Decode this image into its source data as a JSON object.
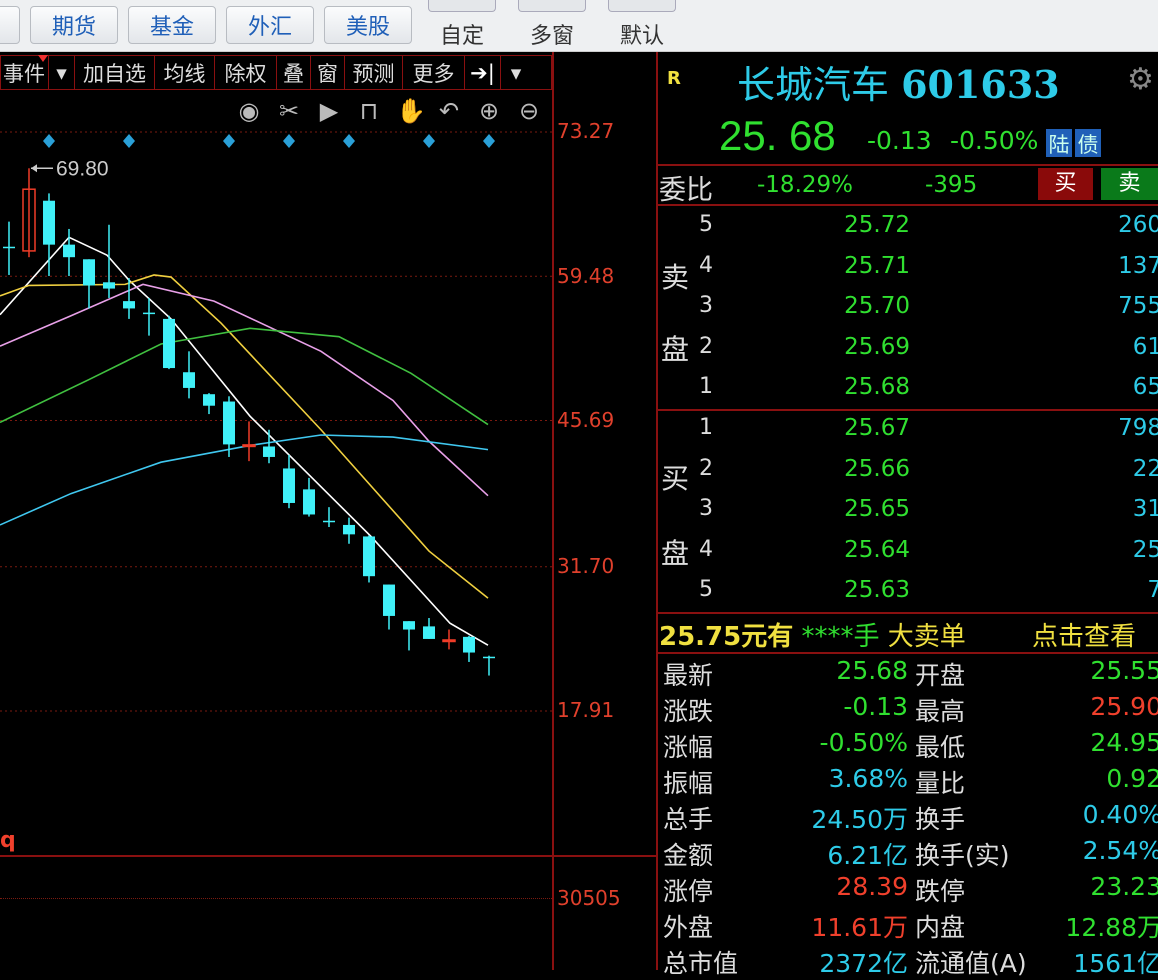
{
  "topbar": {
    "buttons": [
      "期货",
      "基金",
      "外汇",
      "美股"
    ],
    "tools": [
      "自定",
      "多窗",
      "默认"
    ]
  },
  "chart_toolbar": {
    "items": [
      "事件",
      "▾",
      "加自选",
      "均线",
      "除权",
      "叠",
      "窗",
      "预测",
      "更多",
      "➔|",
      "▾"
    ]
  },
  "chart_icons": [
    "eye-icon",
    "scissors-icon",
    "play-icon",
    "lock-icon",
    "hand-icon",
    "undo-icon",
    "zoom-in-icon",
    "zoom-out-icon"
  ],
  "chart_data": {
    "type": "candlestick",
    "y_ticks": [
      "73.27",
      "59.48",
      "45.69",
      "31.70",
      "17.91"
    ],
    "ylim": [
      17.91,
      73.27
    ],
    "high_annotation": "69.80",
    "candles": [
      [
        62.3,
        64.7,
        59.6,
        62.2
      ],
      [
        61.9,
        69.8,
        61.3,
        67.8
      ],
      [
        66.7,
        67.4,
        59.5,
        62.5
      ],
      [
        62.5,
        64.0,
        59.5,
        61.3
      ],
      [
        61.1,
        61.1,
        56.4,
        58.6
      ],
      [
        58.9,
        64.4,
        57.4,
        58.3
      ],
      [
        57.1,
        59.3,
        55.4,
        56.4
      ],
      [
        56.0,
        57.4,
        53.8,
        55.9
      ],
      [
        55.4,
        55.7,
        50.6,
        50.7
      ],
      [
        50.3,
        52.3,
        47.8,
        48.8
      ],
      [
        48.2,
        48.3,
        46.3,
        47.1
      ],
      [
        47.5,
        48.0,
        42.2,
        43.4
      ],
      [
        43.25,
        45.6,
        41.8,
        43.35
      ],
      [
        43.2,
        44.8,
        41.6,
        42.2
      ],
      [
        41.1,
        42.4,
        37.3,
        37.8
      ],
      [
        39.1,
        40.2,
        36.5,
        36.7
      ],
      [
        36.1,
        37.4,
        35.5,
        36.0
      ],
      [
        35.7,
        36.4,
        33.9,
        34.8
      ],
      [
        34.6,
        34.7,
        30.2,
        30.8
      ],
      [
        30.0,
        30.0,
        25.7,
        27.0
      ],
      [
        26.5,
        26.5,
        23.7,
        25.7
      ],
      [
        26.0,
        26.8,
        24.8,
        24.8
      ],
      [
        24.6,
        25.7,
        23.8,
        24.7
      ],
      [
        25.0,
        25.1,
        22.6,
        23.5
      ],
      [
        23.1,
        23.2,
        21.3,
        23.0
      ]
    ],
    "candle_format": [
      "open",
      "high",
      "low",
      "close"
    ],
    "markers_at": [
      2,
      6,
      11,
      14,
      17,
      21,
      24
    ],
    "ma_series": [
      {
        "name": "MA5",
        "color": "#ffffff",
        "points": [
          [
            -0.45,
            55.8
          ],
          [
            3,
            63.2
          ],
          [
            4.9,
            61.5
          ],
          [
            6,
            59.1
          ],
          [
            8.1,
            55.4
          ],
          [
            12.05,
            46.1
          ],
          [
            18.1,
            34.6
          ],
          [
            22.05,
            26.3
          ],
          [
            23.95,
            24.2
          ]
        ]
      },
      {
        "name": "MA10",
        "color": "#f0d040",
        "points": [
          [
            -0.45,
            57.6
          ],
          [
            1,
            58.6
          ],
          [
            5.8,
            58.7
          ],
          [
            7.25,
            59.6
          ],
          [
            8.1,
            59.4
          ],
          [
            10.6,
            55.0
          ],
          [
            15.6,
            44.8
          ],
          [
            21,
            33.2
          ],
          [
            23.95,
            28.7
          ]
        ]
      },
      {
        "name": "MA20",
        "color": "#e8a0e8",
        "points": [
          [
            -0.45,
            52.8
          ],
          [
            3.1,
            55.7
          ],
          [
            6.7,
            58.7
          ],
          [
            10.25,
            57.1
          ],
          [
            15.6,
            52.3
          ],
          [
            19.2,
            47.6
          ],
          [
            21,
            43.7
          ],
          [
            23.95,
            38.5
          ]
        ]
      },
      {
        "name": "MA30",
        "color": "#40c040",
        "points": [
          [
            -0.45,
            45.5
          ],
          [
            4,
            49.6
          ],
          [
            7.6,
            53.0
          ],
          [
            12.05,
            54.5
          ],
          [
            16.5,
            53.7
          ],
          [
            20.1,
            50.2
          ],
          [
            23.95,
            45.3
          ]
        ]
      },
      {
        "name": "MA60",
        "color": "#40c8f0",
        "points": [
          [
            -0.45,
            35.7
          ],
          [
            3.1,
            38.7
          ],
          [
            7.6,
            41.7
          ],
          [
            12.05,
            43.3
          ],
          [
            15.6,
            44.3
          ],
          [
            19.2,
            44.1
          ],
          [
            23.95,
            42.9
          ]
        ]
      }
    ],
    "volume_label": "q",
    "volume_tick": "30505"
  },
  "quote": {
    "r_label": "R",
    "name": "长城汽车",
    "code": "601633",
    "price": "25. 68",
    "change": "-0.13",
    "pct": "-0.50%",
    "tag1": "陆",
    "tag2": "债",
    "weibi_label": "委比",
    "weibi": "-18.29%",
    "weicha": "-395",
    "buy": "买",
    "sell": "卖",
    "sell_label": [
      "卖",
      "盘"
    ],
    "buy_label": [
      "买",
      "盘"
    ],
    "asks": [
      {
        "n": "5",
        "p": "25.72",
        "v": "260"
      },
      {
        "n": "4",
        "p": "25.71",
        "v": "137"
      },
      {
        "n": "3",
        "p": "25.70",
        "v": "755"
      },
      {
        "n": "2",
        "p": "25.69",
        "v": "61"
      },
      {
        "n": "1",
        "p": "25.68",
        "v": "65"
      }
    ],
    "bids": [
      {
        "n": "1",
        "p": "25.67",
        "v": "798"
      },
      {
        "n": "2",
        "p": "25.66",
        "v": "22"
      },
      {
        "n": "3",
        "p": "25.65",
        "v": "31"
      },
      {
        "n": "4",
        "p": "25.64",
        "v": "25"
      },
      {
        "n": "5",
        "p": "25.63",
        "v": "7"
      }
    ],
    "bigorder": {
      "price": "25.75元有",
      "stars": "****手",
      "type": "大卖单",
      "link": "点击查看"
    },
    "stats": [
      {
        "l1": "最新",
        "v1": "25.68",
        "c1": "g",
        "l2": "开盘",
        "v2": "25.55",
        "c2": "g"
      },
      {
        "l1": "涨跌",
        "v1": "-0.13",
        "c1": "g",
        "l2": "最高",
        "v2": "25.90",
        "c2": "r"
      },
      {
        "l1": "涨幅",
        "v1": "-0.50%",
        "c1": "g",
        "l2": "最低",
        "v2": "24.95",
        "c2": "g"
      },
      {
        "l1": "振幅",
        "v1": "3.68%",
        "c1": "c",
        "l2": "量比",
        "v2": "0.92",
        "c2": "g"
      },
      {
        "l1": "总手",
        "v1": "24.50万",
        "c1": "c",
        "l2": "换手",
        "v2": "0.40%",
        "c2": "c"
      },
      {
        "l1": "金额",
        "v1": "6.21亿",
        "c1": "c",
        "l2": "换手(实)",
        "v2": "2.54%",
        "c2": "c"
      },
      {
        "l1": "涨停",
        "v1": "28.39",
        "c1": "r",
        "l2": "跌停",
        "v2": "23.23",
        "c2": "g"
      },
      {
        "l1": "外盘",
        "v1": "11.61万",
        "c1": "r",
        "l2": "内盘",
        "v2": "12.88万",
        "c2": "g"
      },
      {
        "l1": "总市值",
        "v1": "2372亿",
        "c1": "c",
        "l2": "流通值(A)",
        "v2": "1561亿",
        "c2": "c"
      }
    ]
  }
}
